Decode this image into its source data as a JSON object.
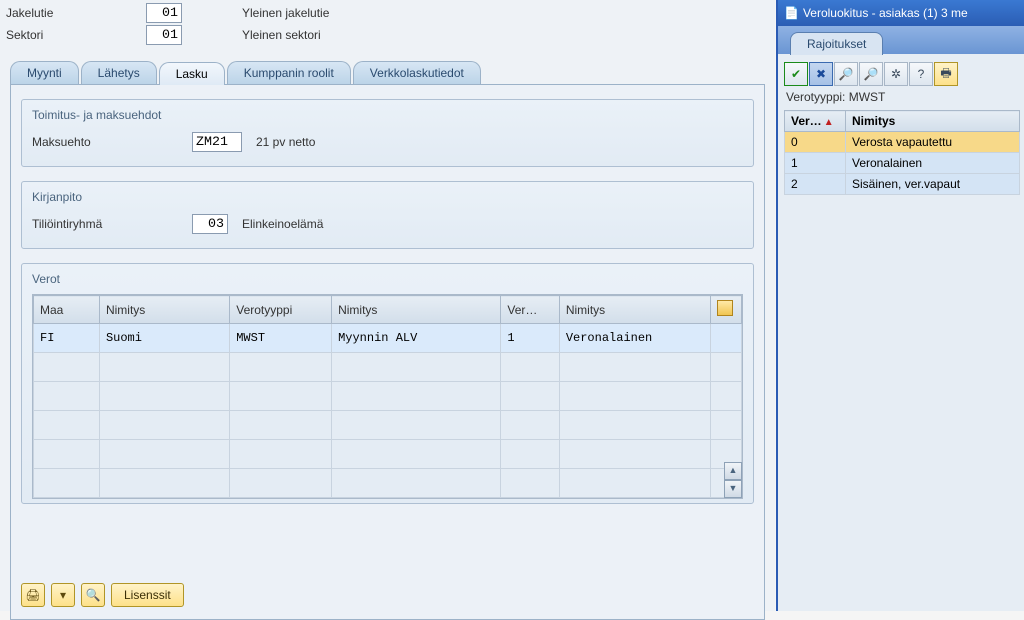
{
  "header": {
    "jakelutie_label": "Jakelutie",
    "jakelutie_code": "01",
    "jakelutie_desc": "Yleinen jakelutie",
    "sektori_label": "Sektori",
    "sektori_code": "01",
    "sektori_desc": "Yleinen sektori"
  },
  "tabs": {
    "myynti": "Myynti",
    "lahetys": "Lähetys",
    "lasku": "Lasku",
    "kumppanin": "Kumppanin roolit",
    "verkkolasku": "Verkkolaskutiedot"
  },
  "groups": {
    "toimitus_title": "Toimitus- ja maksuehdot",
    "maksuehto_label": "Maksuehto",
    "maksuehto_code": "ZM21",
    "maksuehto_desc": "21 pv netto",
    "kirjanpito_title": "Kirjanpito",
    "tilioryhma_label": "Tiliöintiryhmä",
    "tilioryhma_code": "03",
    "tilioryhma_desc": "Elinkeinoelämä",
    "verot_title": "Verot"
  },
  "verot": {
    "headers": {
      "maa": "Maa",
      "nimitys1": "Nimitys",
      "verotyyppi": "Verotyyppi",
      "nimitys2": "Nimitys",
      "ver": "Ver…",
      "nimitys3": "Nimitys"
    },
    "rows": [
      {
        "maa": "FI",
        "nimitys1": "Suomi",
        "verotyyppi": "MWST",
        "nimitys2": "Myynnin ALV",
        "ver": "1",
        "nimitys3": "Veronalainen"
      }
    ]
  },
  "buttons": {
    "lisenssit": "Lisenssit"
  },
  "popup": {
    "title": "Veroluokitus - asiakas (1)    3 me",
    "tab": "Rajoitukset",
    "verotyyppi_line": "Verotyyppi: MWST",
    "headers": {
      "ver": "Ver…",
      "nimitys": "Nimitys"
    },
    "rows": [
      {
        "code": "0",
        "name": "Verosta vapautettu",
        "selected": true
      },
      {
        "code": "1",
        "name": "Veronalainen",
        "selected": false
      },
      {
        "code": "2",
        "name": "Sisäinen, ver.vapaut",
        "selected": false
      }
    ]
  }
}
